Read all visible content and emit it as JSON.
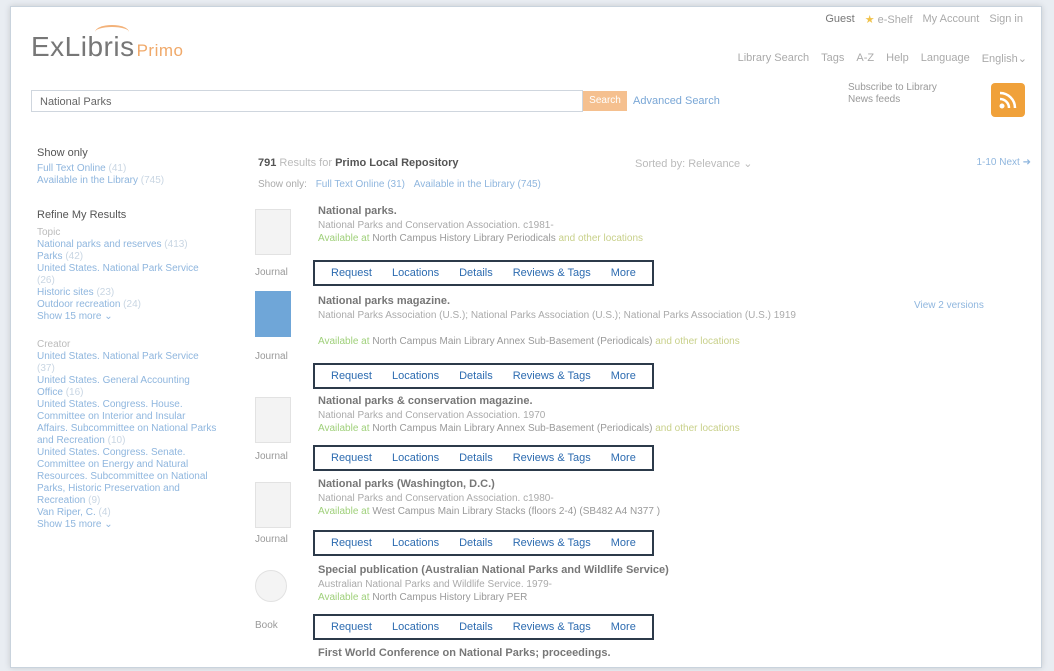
{
  "header": {
    "logo_main": "ExLibris",
    "logo_sub": "Primo",
    "guest": "Guest",
    "eshelf": "e-Shelf",
    "my_account": "My Account",
    "sign_in": "Sign in",
    "nav": [
      "Library Search",
      "Tags",
      "A-Z",
      "Help",
      "Language",
      "English"
    ]
  },
  "search": {
    "value": "National Parks",
    "button": "Search",
    "advanced": "Advanced Search",
    "subscribe": "Subscribe to Library News feeds"
  },
  "left": {
    "show_only_title": "Show only",
    "show_only": [
      {
        "label": "Full Text Online",
        "count": "(41)"
      },
      {
        "label": "Available in the Library",
        "count": "(745)"
      }
    ],
    "refine_title": "Refine My Results",
    "topic_title": "Topic",
    "topics": [
      {
        "label": "National parks and reserves",
        "count": "(413)"
      },
      {
        "label": "Parks",
        "count": "(42)"
      },
      {
        "label": "United States. National Park Service",
        "count": "(26)"
      },
      {
        "label": "Historic sites",
        "count": "(23)"
      },
      {
        "label": "Outdoor recreation",
        "count": "(24)"
      }
    ],
    "show_more": "Show 15 more",
    "creator_title": "Creator",
    "creators": [
      {
        "label": "United States. National Park Service",
        "count": "(37)"
      },
      {
        "label": "United States. General Accounting Office",
        "count": "(16)"
      },
      {
        "label": "United States. Congress. House. Committee on Interior and Insular Affairs. Subcommittee on National Parks and Recreation",
        "count": "(10)"
      },
      {
        "label": "United States. Congress. Senate. Committee on Energy and Natural Resources. Subcommittee on National Parks, Historic Preservation and Recreation",
        "count": "(9)"
      },
      {
        "label": "Van Riper, C.",
        "count": "(4)"
      }
    ],
    "show_more_2": "Show 15 more"
  },
  "results": {
    "count": "791",
    "results_for": "Results for",
    "repository": "Primo Local Repository",
    "sorted_by": "Sorted by:",
    "sort_value": "Relevance",
    "pager": "1-10 Next",
    "show_only": "Show only:",
    "show_only_fulltext": "Full Text Online (31)",
    "show_only_available": "Available in the Library (745)",
    "view_versions": "View 2 versions",
    "actions": [
      "Request",
      "Locations",
      "Details",
      "Reviews & Tags",
      "More"
    ],
    "records": [
      {
        "type": "Journal",
        "title": "National parks.",
        "sub": "National Parks and Conservation Association. c1981-",
        "avail_prefix": "Available at",
        "avail_loc": "North Campus History Library Periodicals",
        "other": "and other locations"
      },
      {
        "type": "Journal",
        "title": "National parks magazine.",
        "sub": "National Parks Association (U.S.); National Parks Association (U.S.); National Parks Association (U.S.) 1919",
        "avail_prefix": "Available at",
        "avail_loc": "North Campus Main Library Annex Sub-Basement (Periodicals)",
        "other": "and other locations"
      },
      {
        "type": "Journal",
        "title": "National parks & conservation magazine.",
        "sub": "National Parks and Conservation Association. 1970",
        "avail_prefix": "Available at",
        "avail_loc": "North Campus Main Library Annex Sub-Basement (Periodicals)",
        "other": "and other locations"
      },
      {
        "type": "Journal",
        "title": "National parks (Washington, D.C.)",
        "sub": "National Parks and Conservation Association. c1980-",
        "avail_prefix": "Available at",
        "avail_loc": "West Campus Main Library Stacks (floors 2-4) (SB482 A4 N377 )",
        "other": ""
      },
      {
        "type": "Book",
        "title": "Special publication (Australian National Parks and Wildlife Service)",
        "sub": "Australian National Parks and Wildlife Service. 1979-",
        "avail_prefix": "Available at",
        "avail_loc": "North Campus History Library PER",
        "other": ""
      },
      {
        "type": "",
        "title": "First World Conference on National Parks; proceedings.",
        "sub": "",
        "avail_prefix": "",
        "avail_loc": "",
        "other": ""
      }
    ]
  }
}
